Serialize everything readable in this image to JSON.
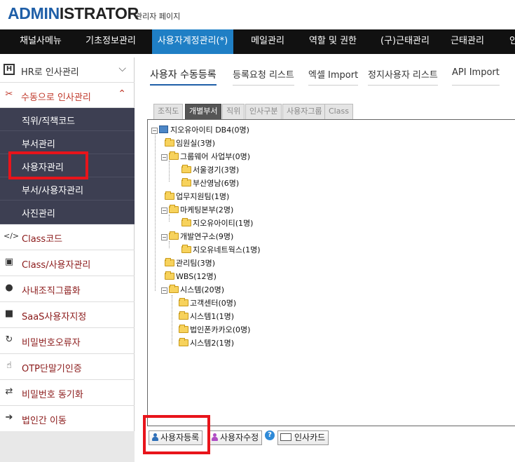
{
  "header": {
    "logo_a": "ADMIN",
    "logo_b": "ISTRATOR",
    "subtitle": "관리자 페이지"
  },
  "topnav": [
    "채널사메뉴",
    "기초정보관리",
    "사용자계정관리(*)",
    "메일관리",
    "역할 및 권한",
    "(구)근태관리",
    "근태관리",
    "인"
  ],
  "sidebar": {
    "hr": "HR로 인사관리",
    "manual": "수동으로 인사관리",
    "sub": [
      "직위/직책코드",
      "부서관리",
      "사용자관리",
      "부서/사용자관리",
      "사진관리"
    ],
    "items": [
      "Class코드",
      "Class/사용자관리",
      "사내조직그룹화",
      "SaaS사용자지정",
      "비밀번호오류자",
      "OTP단말기인증",
      "비밀번호 동기화",
      "법인간 이동"
    ]
  },
  "tabs": [
    "사용자 수동등록",
    "등록요청 리스트",
    "엑셀 Import",
    "정지사용자 리스트",
    "API Import"
  ],
  "subtabs": [
    "조직도",
    "개별부서",
    "직위",
    "인사구분",
    "사용자그룹",
    "Class"
  ],
  "tree": [
    "지오유아이티 DB4(0명)",
    "임원실(3명)",
    "그룹웨어 사업부(0명)",
    "서울경기(3명)",
    "부산영남(6명)",
    "업무지원팀(1명)",
    "마케팅본부(2명)",
    "지오유아이티(1명)",
    "개발연구소(9명)",
    "지오유네트웍스(1명)",
    "관리팀(3명)",
    "WBS(12명)",
    "시스템(20명)",
    "고객센터(0명)",
    "시스템1(1명)",
    "법인폰카카오(0명)",
    "시스템2(1명)"
  ],
  "buttons": {
    "register": "사용자등록",
    "edit": "사용자수정",
    "help": "?",
    "card": "인사카드"
  },
  "colors": {
    "accent": "#1f7fc5",
    "highlight": "#e8141b"
  }
}
